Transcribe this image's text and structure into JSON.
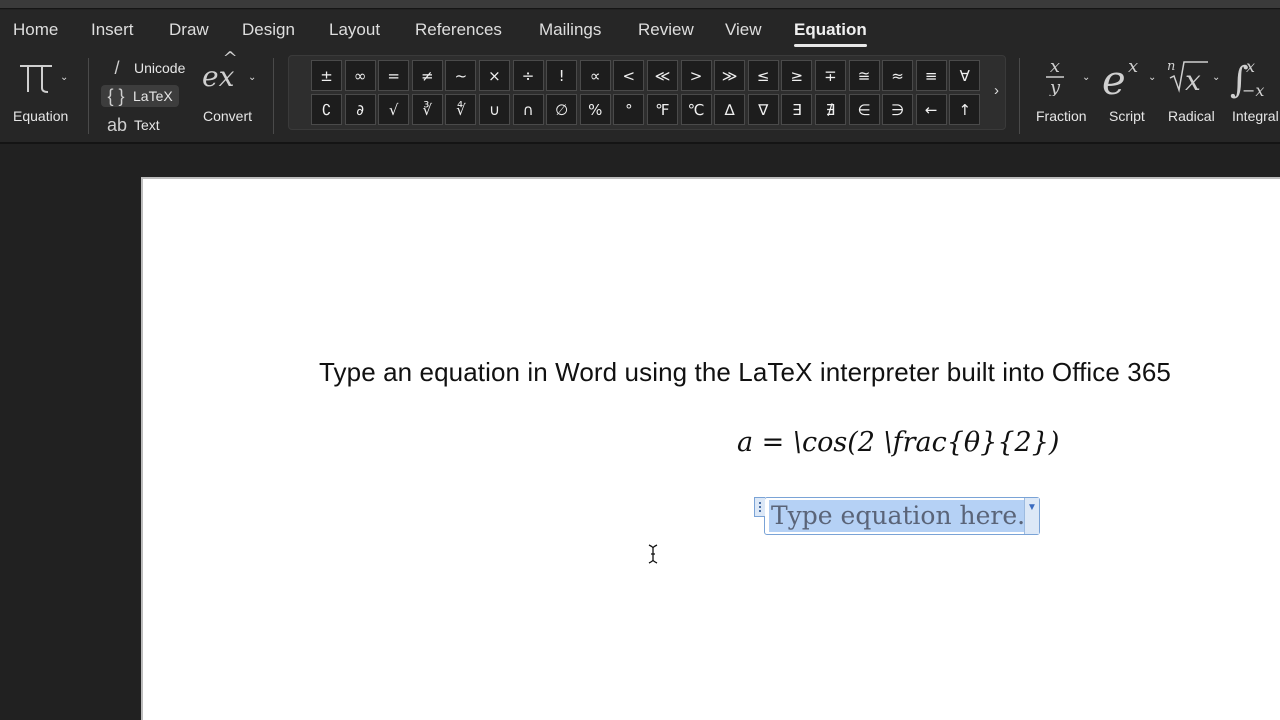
{
  "tabs": [
    {
      "label": "Home",
      "active": false
    },
    {
      "label": "Insert",
      "active": false
    },
    {
      "label": "Draw",
      "active": false
    },
    {
      "label": "Design",
      "active": false
    },
    {
      "label": "Layout",
      "active": false
    },
    {
      "label": "References",
      "active": false
    },
    {
      "label": "Mailings",
      "active": false
    },
    {
      "label": "Review",
      "active": false
    },
    {
      "label": "View",
      "active": false
    },
    {
      "label": "Equation",
      "active": true
    }
  ],
  "ribbon": {
    "equation": {
      "label": "Equation",
      "glyph": "π",
      "icon": "pi-icon"
    },
    "modes": [
      {
        "label": "Unicode",
        "glyph": "/",
        "icon": "slash-icon",
        "selected": false
      },
      {
        "label": "LaTeX",
        "glyph": "{ }",
        "icon": "braces-icon",
        "selected": true
      },
      {
        "label": "Text",
        "glyph": "ab",
        "icon": "ab-text-icon",
        "selected": false
      }
    ],
    "convert": {
      "label": "Convert",
      "glyph": "ex̂"
    },
    "symbols_row1": [
      "±",
      "∞",
      "=",
      "≠",
      "~",
      "×",
      "÷",
      "!",
      "∝",
      "<",
      "≪",
      ">",
      "≫",
      "≤",
      "≥",
      "∓",
      "≅",
      "≈",
      "≡",
      "∀"
    ],
    "symbols_row2": [
      "∁",
      "∂",
      "√",
      "∛",
      "∜",
      "∪",
      "∩",
      "∅",
      "%",
      "°",
      "℉",
      "℃",
      "∆",
      "∇",
      "∃",
      "∄",
      "∈",
      "∋",
      "←",
      "↑"
    ],
    "structures": [
      {
        "label": "Fraction",
        "icon": "fraction-icon"
      },
      {
        "label": "Script",
        "icon": "script-icon"
      },
      {
        "label": "Radical",
        "icon": "radical-icon"
      },
      {
        "label": "Integral",
        "icon": "integral-icon"
      }
    ]
  },
  "document": {
    "heading": "Type an equation in Word using the LaTeX interpreter built into Office 365",
    "equation": "a = \\cos(2 \\frac{θ}{2})",
    "placeholder": "Type equation here."
  },
  "colors": {
    "selection": "#b5d1f5",
    "equation_border": "#7aa3d6"
  }
}
